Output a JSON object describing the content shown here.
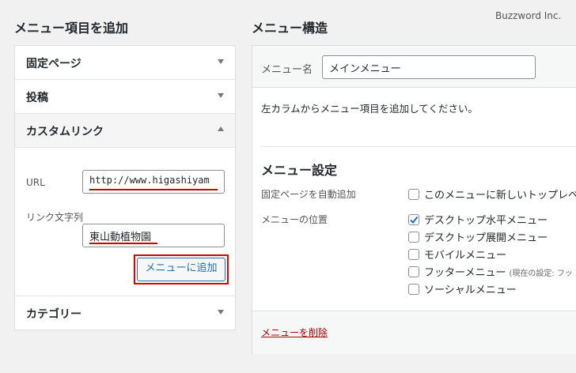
{
  "left": {
    "heading": "メニュー項目を追加",
    "accordion": [
      {
        "label": "固定ページ",
        "open": false
      },
      {
        "label": "投稿",
        "open": false
      },
      {
        "label": "カスタムリンク",
        "open": true
      },
      {
        "label": "カテゴリー",
        "open": false
      }
    ],
    "custom_link": {
      "url_label": "URL",
      "url_value": "http://www.higashiyam",
      "text_label": "リンク文字列",
      "text_value": "東山動植物園",
      "add_button": "メニューに追加"
    }
  },
  "right": {
    "heading": "メニュー構造",
    "menu_name_label": "メニュー名",
    "menu_name_value": "メインメニュー",
    "description": "左カラムからメニュー項目を追加してください。",
    "settings_title": "メニュー設定",
    "auto_add_label": "固定ページを自動追加",
    "auto_add_option": "このメニューに新しいトップレベ",
    "location_label": "メニューの位置",
    "locations": [
      {
        "label": "デスクトップ水平メニュー",
        "checked": true,
        "note": ""
      },
      {
        "label": "デスクトップ展開メニュー",
        "checked": false,
        "note": ""
      },
      {
        "label": "モバイルメニュー",
        "checked": false,
        "note": ""
      },
      {
        "label": "フッターメニュー",
        "checked": false,
        "note": "(現在の設定: フッ"
      },
      {
        "label": "ソーシャルメニュー",
        "checked": false,
        "note": ""
      }
    ],
    "delete_link": "メニューを削除"
  },
  "watermark": "Buzzword Inc.",
  "colors": {
    "accent": "#2271b1",
    "highlight": "#dd0000",
    "delete": "#aa0000"
  }
}
